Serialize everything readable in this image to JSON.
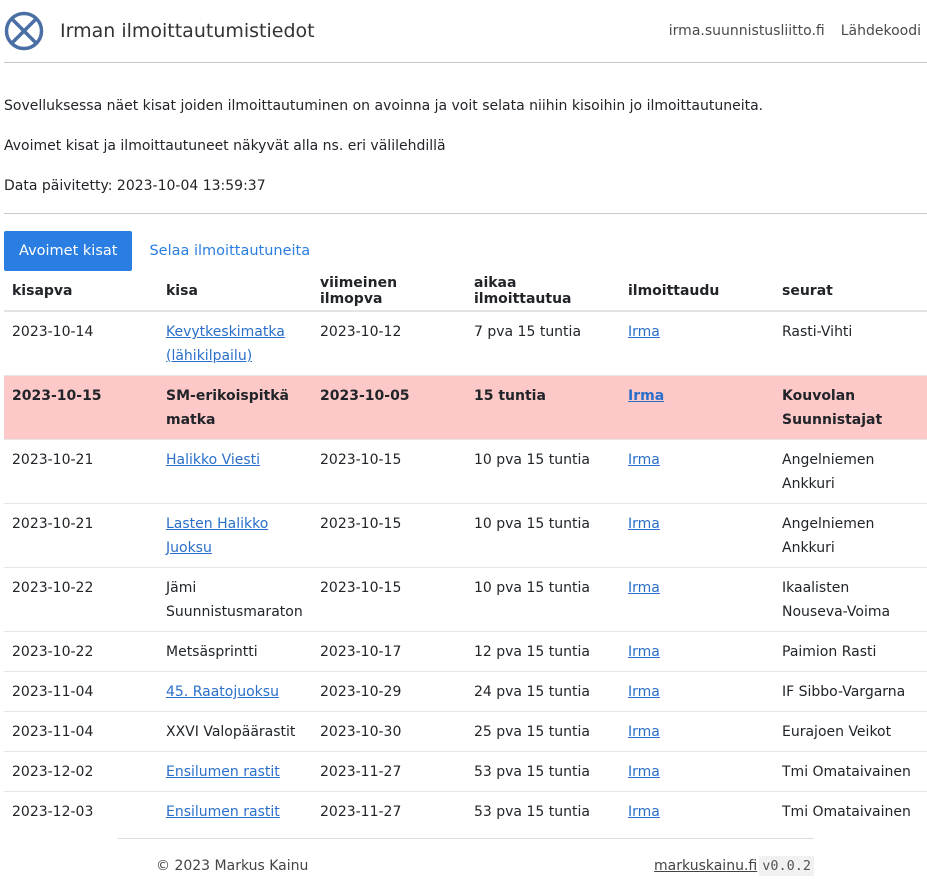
{
  "header": {
    "title": "Irman ilmoittautumistiedot",
    "links": [
      "irma.suunnistusliitto.fi",
      "Lähdekoodi"
    ]
  },
  "intro": {
    "line1": "Sovelluksessa näet kisat joiden ilmoittautuminen on avoinna ja voit selata niihin kisoihin jo ilmoittautuneita.",
    "line2": "Avoimet kisat ja ilmoittautuneet näkyvät alla ns. eri välilehdillä",
    "line3": "Data päivitetty: 2023-10-04 13:59:37"
  },
  "tabs": {
    "active": "Avoimet kisat",
    "other": "Selaa ilmoittautuneita"
  },
  "table": {
    "headers": [
      "kisapva",
      "kisa",
      "viimeinen ilmopva",
      "aikaa ilmoittautua",
      "ilmoittaudu",
      "seurat"
    ],
    "rows": [
      {
        "date": "2023-10-14",
        "name": "Kevytkeskimatka (lähikilpailu)",
        "deadline": "2023-10-12",
        "time_left": "7 pva 15 tuntia",
        "signup": "Irma",
        "clubs": "Rasti-Vihti"
      },
      {
        "date": "2023-10-15",
        "name": "SM-erikoispitkä matka",
        "deadline": "2023-10-05",
        "time_left": "15 tuntia",
        "signup": "Irma",
        "clubs": "Kouvolan Suunnistajat"
      },
      {
        "date": "2023-10-21",
        "name": "Halikko Viesti",
        "deadline": "2023-10-15",
        "time_left": "10 pva 15 tuntia",
        "signup": "Irma",
        "clubs": "Angelniemen Ankkuri"
      },
      {
        "date": "2023-10-21",
        "name": "Lasten Halikko Juoksu",
        "deadline": "2023-10-15",
        "time_left": "10 pva 15 tuntia",
        "signup": "Irma",
        "clubs": "Angelniemen Ankkuri"
      },
      {
        "date": "2023-10-22",
        "name": "Jämi Suunnistusmaraton",
        "deadline": "2023-10-15",
        "time_left": "10 pva 15 tuntia",
        "signup": "Irma",
        "clubs": "Ikaalisten Nouseva-Voima"
      },
      {
        "date": "2023-10-22",
        "name": "Metsäsprintti",
        "deadline": "2023-10-17",
        "time_left": "12 pva 15 tuntia",
        "signup": "Irma",
        "clubs": "Paimion Rasti"
      },
      {
        "date": "2023-11-04",
        "name": "45. Raatojuoksu",
        "deadline": "2023-10-29",
        "time_left": "24 pva 15 tuntia",
        "signup": "Irma",
        "clubs": "IF Sibbo-Vargarna"
      },
      {
        "date": "2023-11-04",
        "name": "XXVI Valopäärastit",
        "deadline": "2023-10-30",
        "time_left": "25 pva 15 tuntia",
        "signup": "Irma",
        "clubs": "Eurajoen Veikot"
      },
      {
        "date": "2023-12-02",
        "name": "Ensilumen rastit",
        "deadline": "2023-11-27",
        "time_left": "53 pva 15 tuntia",
        "signup": "Irma",
        "clubs": "Tmi Omataivainen"
      },
      {
        "date": "2023-12-03",
        "name": "Ensilumen rastit",
        "deadline": "2023-11-27",
        "time_left": "53 pva 15 tuntia",
        "signup": "Irma",
        "clubs": "Tmi Omataivainen"
      }
    ]
  },
  "footer": {
    "copyright": "© 2023 Markus Kainu",
    "site": "markuskainu.fi",
    "version": "v0.0.2"
  }
}
